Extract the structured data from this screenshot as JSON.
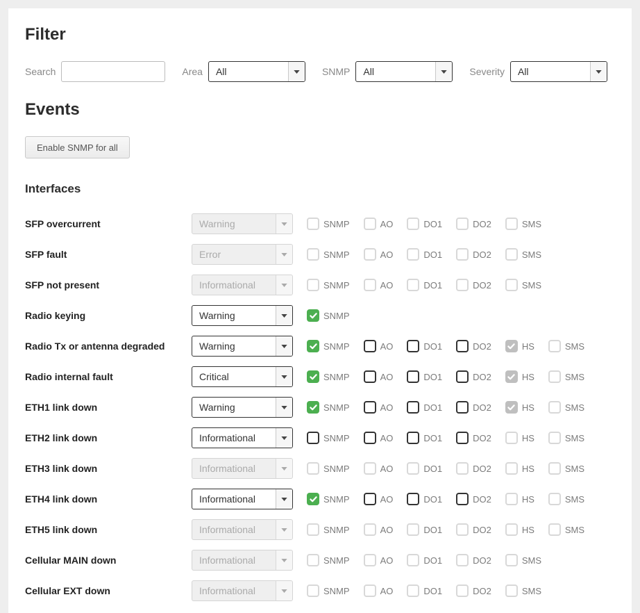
{
  "filter": {
    "title": "Filter",
    "search_label": "Search",
    "search_value": "",
    "area_label": "Area",
    "area_value": "All",
    "snmp_label": "SNMP",
    "snmp_value": "All",
    "severity_label": "Severity",
    "severity_value": "All"
  },
  "events": {
    "title": "Events",
    "enable_all_label": "Enable SNMP for all",
    "section_title": "Interfaces",
    "rows": [
      {
        "name": "SFP overcurrent",
        "severity": "Warning",
        "disabled": true,
        "checks": [
          {
            "label": "SNMP",
            "checked": false,
            "disabled": true
          },
          {
            "label": "AO",
            "checked": false,
            "disabled": true
          },
          {
            "label": "DO1",
            "checked": false,
            "disabled": true
          },
          {
            "label": "DO2",
            "checked": false,
            "disabled": true
          },
          {
            "label": "SMS",
            "checked": false,
            "disabled": true
          }
        ]
      },
      {
        "name": "SFP fault",
        "severity": "Error",
        "disabled": true,
        "checks": [
          {
            "label": "SNMP",
            "checked": false,
            "disabled": true
          },
          {
            "label": "AO",
            "checked": false,
            "disabled": true
          },
          {
            "label": "DO1",
            "checked": false,
            "disabled": true
          },
          {
            "label": "DO2",
            "checked": false,
            "disabled": true
          },
          {
            "label": "SMS",
            "checked": false,
            "disabled": true
          }
        ]
      },
      {
        "name": "SFP not present",
        "severity": "Informational",
        "disabled": true,
        "checks": [
          {
            "label": "SNMP",
            "checked": false,
            "disabled": true
          },
          {
            "label": "AO",
            "checked": false,
            "disabled": true
          },
          {
            "label": "DO1",
            "checked": false,
            "disabled": true
          },
          {
            "label": "DO2",
            "checked": false,
            "disabled": true
          },
          {
            "label": "SMS",
            "checked": false,
            "disabled": true
          }
        ]
      },
      {
        "name": "Radio keying",
        "severity": "Warning",
        "disabled": false,
        "checks": [
          {
            "label": "SNMP",
            "checked": true,
            "disabled": false
          }
        ]
      },
      {
        "name": "Radio Tx or antenna degraded",
        "severity": "Warning",
        "disabled": false,
        "checks": [
          {
            "label": "SNMP",
            "checked": true,
            "disabled": false
          },
          {
            "label": "AO",
            "checked": false,
            "disabled": false
          },
          {
            "label": "DO1",
            "checked": false,
            "disabled": false
          },
          {
            "label": "DO2",
            "checked": false,
            "disabled": false
          },
          {
            "label": "HS",
            "checked": true,
            "disabled": true
          },
          {
            "label": "SMS",
            "checked": false,
            "disabled": true
          }
        ]
      },
      {
        "name": "Radio internal fault",
        "severity": "Critical",
        "disabled": false,
        "checks": [
          {
            "label": "SNMP",
            "checked": true,
            "disabled": false
          },
          {
            "label": "AO",
            "checked": false,
            "disabled": false
          },
          {
            "label": "DO1",
            "checked": false,
            "disabled": false
          },
          {
            "label": "DO2",
            "checked": false,
            "disabled": false
          },
          {
            "label": "HS",
            "checked": true,
            "disabled": true
          },
          {
            "label": "SMS",
            "checked": false,
            "disabled": true
          }
        ]
      },
      {
        "name": "ETH1 link down",
        "severity": "Warning",
        "disabled": false,
        "checks": [
          {
            "label": "SNMP",
            "checked": true,
            "disabled": false
          },
          {
            "label": "AO",
            "checked": false,
            "disabled": false
          },
          {
            "label": "DO1",
            "checked": false,
            "disabled": false
          },
          {
            "label": "DO2",
            "checked": false,
            "disabled": false
          },
          {
            "label": "HS",
            "checked": true,
            "disabled": true
          },
          {
            "label": "SMS",
            "checked": false,
            "disabled": true
          }
        ]
      },
      {
        "name": "ETH2 link down",
        "severity": "Informational",
        "disabled": false,
        "checks": [
          {
            "label": "SNMP",
            "checked": false,
            "disabled": false
          },
          {
            "label": "AO",
            "checked": false,
            "disabled": false
          },
          {
            "label": "DO1",
            "checked": false,
            "disabled": false
          },
          {
            "label": "DO2",
            "checked": false,
            "disabled": false
          },
          {
            "label": "HS",
            "checked": false,
            "disabled": true
          },
          {
            "label": "SMS",
            "checked": false,
            "disabled": true
          }
        ]
      },
      {
        "name": "ETH3 link down",
        "severity": "Informational",
        "disabled": true,
        "checks": [
          {
            "label": "SNMP",
            "checked": false,
            "disabled": true
          },
          {
            "label": "AO",
            "checked": false,
            "disabled": true
          },
          {
            "label": "DO1",
            "checked": false,
            "disabled": true
          },
          {
            "label": "DO2",
            "checked": false,
            "disabled": true
          },
          {
            "label": "HS",
            "checked": false,
            "disabled": true
          },
          {
            "label": "SMS",
            "checked": false,
            "disabled": true
          }
        ]
      },
      {
        "name": "ETH4 link down",
        "severity": "Informational",
        "disabled": false,
        "checks": [
          {
            "label": "SNMP",
            "checked": true,
            "disabled": false
          },
          {
            "label": "AO",
            "checked": false,
            "disabled": false
          },
          {
            "label": "DO1",
            "checked": false,
            "disabled": false
          },
          {
            "label": "DO2",
            "checked": false,
            "disabled": false
          },
          {
            "label": "HS",
            "checked": false,
            "disabled": true
          },
          {
            "label": "SMS",
            "checked": false,
            "disabled": true
          }
        ]
      },
      {
        "name": "ETH5 link down",
        "severity": "Informational",
        "disabled": true,
        "checks": [
          {
            "label": "SNMP",
            "checked": false,
            "disabled": true
          },
          {
            "label": "AO",
            "checked": false,
            "disabled": true
          },
          {
            "label": "DO1",
            "checked": false,
            "disabled": true
          },
          {
            "label": "DO2",
            "checked": false,
            "disabled": true
          },
          {
            "label": "HS",
            "checked": false,
            "disabled": true
          },
          {
            "label": "SMS",
            "checked": false,
            "disabled": true
          }
        ]
      },
      {
        "name": "Cellular MAIN down",
        "severity": "Informational",
        "disabled": true,
        "checks": [
          {
            "label": "SNMP",
            "checked": false,
            "disabled": true
          },
          {
            "label": "AO",
            "checked": false,
            "disabled": true
          },
          {
            "label": "DO1",
            "checked": false,
            "disabled": true
          },
          {
            "label": "DO2",
            "checked": false,
            "disabled": true
          },
          {
            "label": "SMS",
            "checked": false,
            "disabled": true
          }
        ]
      },
      {
        "name": "Cellular EXT down",
        "severity": "Informational",
        "disabled": true,
        "checks": [
          {
            "label": "SNMP",
            "checked": false,
            "disabled": true
          },
          {
            "label": "AO",
            "checked": false,
            "disabled": true
          },
          {
            "label": "DO1",
            "checked": false,
            "disabled": true
          },
          {
            "label": "DO2",
            "checked": false,
            "disabled": true
          },
          {
            "label": "SMS",
            "checked": false,
            "disabled": true
          }
        ]
      }
    ]
  }
}
